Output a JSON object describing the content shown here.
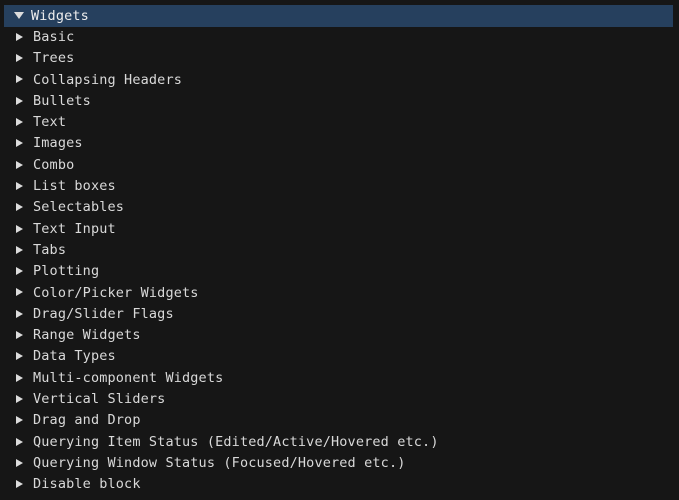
{
  "window": {
    "background_color": "#161616",
    "text_color": "#d9d9d9",
    "highlight_color": "#26405e"
  },
  "tree": {
    "root": {
      "label": "Widgets",
      "icon": "chevron-down-icon",
      "expanded": true,
      "selected": true
    },
    "items": [
      {
        "label": "Basic",
        "icon": "chevron-right-icon"
      },
      {
        "label": "Trees",
        "icon": "chevron-right-icon"
      },
      {
        "label": "Collapsing Headers",
        "icon": "chevron-right-icon"
      },
      {
        "label": "Bullets",
        "icon": "chevron-right-icon"
      },
      {
        "label": "Text",
        "icon": "chevron-right-icon"
      },
      {
        "label": "Images",
        "icon": "chevron-right-icon"
      },
      {
        "label": "Combo",
        "icon": "chevron-right-icon"
      },
      {
        "label": "List boxes",
        "icon": "chevron-right-icon"
      },
      {
        "label": "Selectables",
        "icon": "chevron-right-icon"
      },
      {
        "label": "Text Input",
        "icon": "chevron-right-icon"
      },
      {
        "label": "Tabs",
        "icon": "chevron-right-icon"
      },
      {
        "label": "Plotting",
        "icon": "chevron-right-icon"
      },
      {
        "label": "Color/Picker Widgets",
        "icon": "chevron-right-icon"
      },
      {
        "label": "Drag/Slider Flags",
        "icon": "chevron-right-icon"
      },
      {
        "label": "Range Widgets",
        "icon": "chevron-right-icon"
      },
      {
        "label": "Data Types",
        "icon": "chevron-right-icon"
      },
      {
        "label": "Multi-component Widgets",
        "icon": "chevron-right-icon"
      },
      {
        "label": "Vertical Sliders",
        "icon": "chevron-right-icon"
      },
      {
        "label": "Drag and Drop",
        "icon": "chevron-right-icon"
      },
      {
        "label": "Querying Item Status (Edited/Active/Hovered etc.)",
        "icon": "chevron-right-icon"
      },
      {
        "label": "Querying Window Status (Focused/Hovered etc.)",
        "icon": "chevron-right-icon"
      },
      {
        "label": "Disable block",
        "icon": "chevron-right-icon"
      }
    ]
  }
}
